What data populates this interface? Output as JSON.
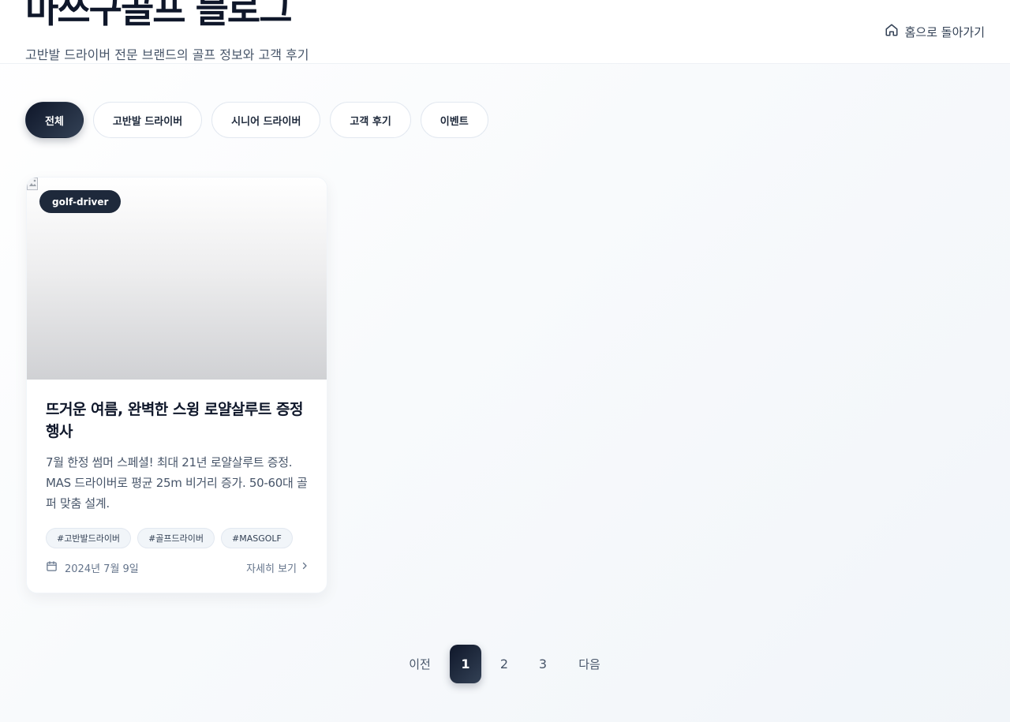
{
  "header": {
    "title": "마쓰구골프 블로그",
    "subtitle": "고반발 드라이버 전문 브랜드의 골프 정보와 고객 후기",
    "home_label": "홈으로 돌아가기",
    "home_icon": "home-icon"
  },
  "categories": [
    {
      "label": "전체",
      "active": true
    },
    {
      "label": "고반발 드라이버",
      "active": false
    },
    {
      "label": "시니어 드라이버",
      "active": false
    },
    {
      "label": "고객 후기",
      "active": false
    },
    {
      "label": "이벤트",
      "active": false
    }
  ],
  "posts": [
    {
      "badge": "golf-driver",
      "title": "뜨거운 여름, 완벽한 스윙 로얄살루트 증정 행사",
      "description": "7월 한정 썸머 스페셜! 최대 21년 로얄살루트 증정. MAS 드라이버로 평균 25m 비거리 증가. 50-60대 골퍼 맞춤 설계.",
      "tags": [
        "#고반발드라이버",
        "#골프드라이버",
        "#MASGOLF"
      ],
      "date": "2024년 7월 9일",
      "read_more": "자세히 보기"
    }
  ],
  "pagination": {
    "prev": "이전",
    "pages": [
      "1",
      "2",
      "3"
    ],
    "current": "1",
    "next": "다음"
  },
  "colors": {
    "primary_dark": "#0f172a",
    "accent_gradient_end": "#334155",
    "text_muted": "#64748b"
  }
}
